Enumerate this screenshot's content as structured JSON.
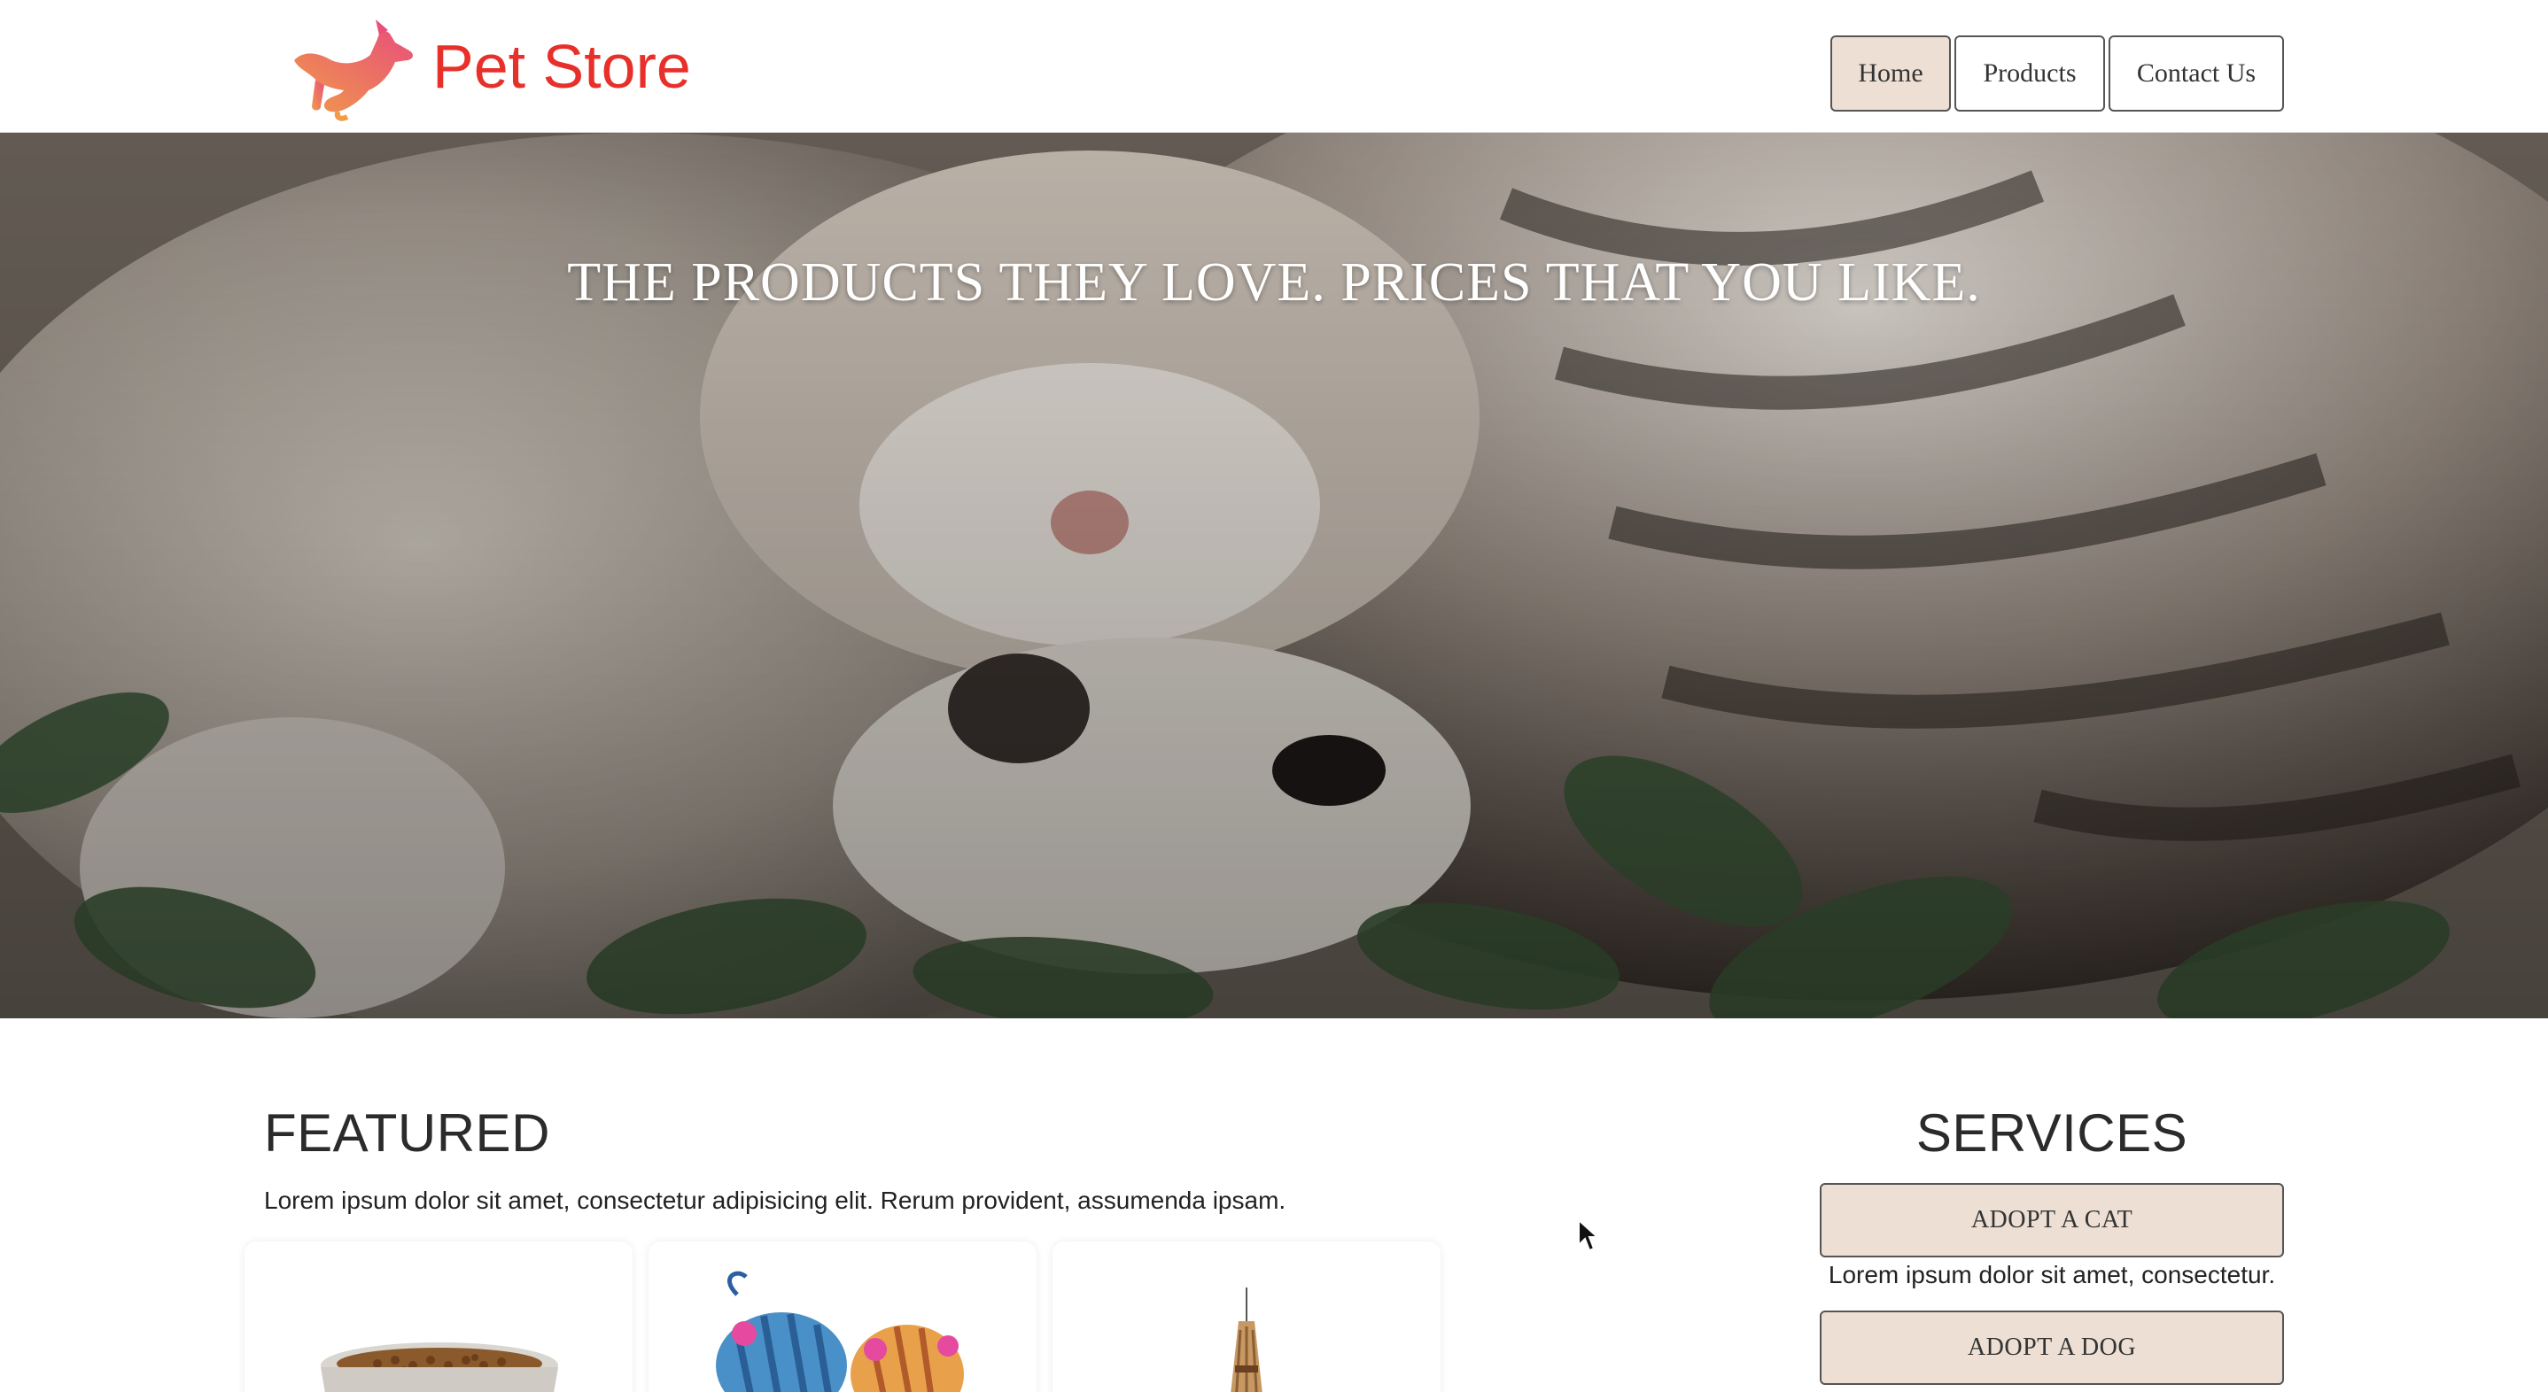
{
  "header": {
    "brand": "Pet Store",
    "logo_icon": "dog-logo-icon",
    "nav": [
      {
        "label": "Home",
        "active": true
      },
      {
        "label": "Products",
        "active": false
      },
      {
        "label": "Contact Us",
        "active": false
      }
    ]
  },
  "hero": {
    "title": "THE PRODUCTS THEY LOVE. PRICES THAT YOU LIKE."
  },
  "featured": {
    "title": "FEATURED",
    "text": "Lorem ipsum dolor sit amet, consectetur adipisicing elit. Rerum provident, assumenda ipsam.",
    "cards": [
      {
        "image": "pet-food-bowl"
      },
      {
        "image": "mouse-toys"
      },
      {
        "image": "cat-feather-toy"
      }
    ]
  },
  "services": {
    "title": "SERVICES",
    "items": [
      {
        "label": "ADOPT A CAT",
        "text": "Lorem ipsum dolor sit amet, consectetur."
      },
      {
        "label": "ADOPT A DOG"
      }
    ]
  },
  "colors": {
    "brand": "#e8302a",
    "button_bg": "#eddfd3",
    "border": "#555555"
  }
}
